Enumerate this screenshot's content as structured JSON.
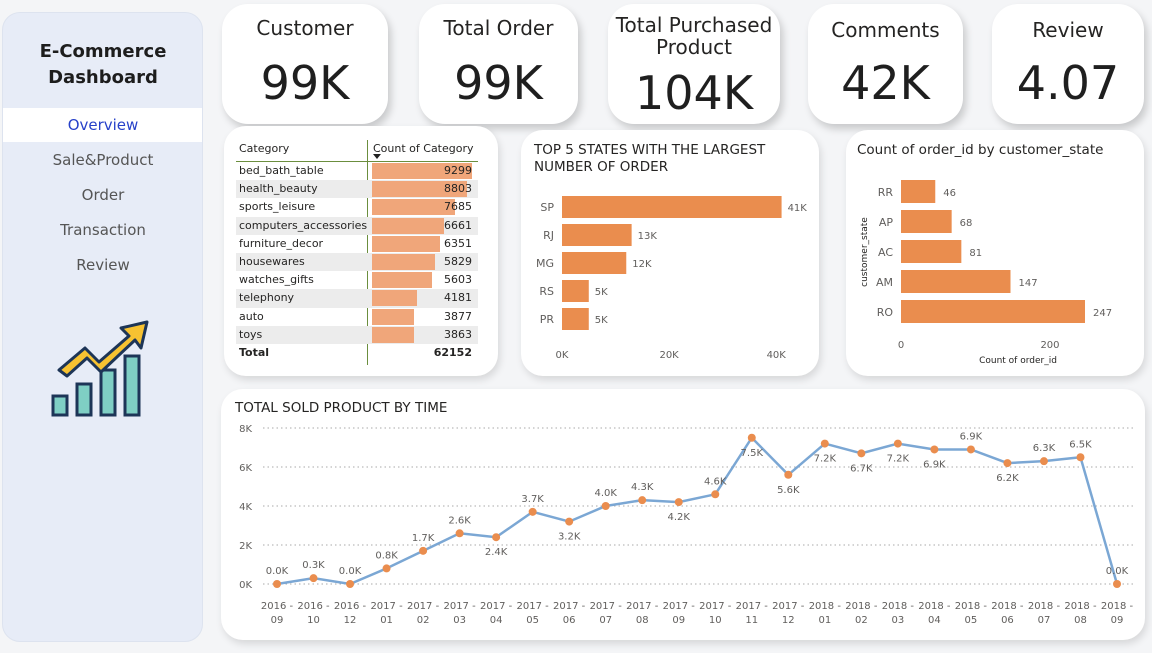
{
  "sidebar": {
    "title_line1": "E-Commerce",
    "title_line2": "Dashboard",
    "nav": [
      "Overview",
      "Sale&Product",
      "Order",
      "Transaction",
      "Review"
    ]
  },
  "kpis": [
    {
      "title": "Customer",
      "value": "99K"
    },
    {
      "title": "Total Order",
      "value": "99K"
    },
    {
      "title_line1": "Total Purchased",
      "title_line2": "Product",
      "value": "104K"
    },
    {
      "title": "Comments",
      "value": "42K"
    },
    {
      "title": "Review",
      "value": "4.07"
    }
  ],
  "category_table": {
    "col_category": "Category",
    "col_count": "Count of Category",
    "rows": [
      {
        "category": "bed_bath_table",
        "count": "9299"
      },
      {
        "category": "health_beauty",
        "count": "8803"
      },
      {
        "category": "sports_leisure",
        "count": "7685"
      },
      {
        "category": "computers_accessories",
        "count": "6661"
      },
      {
        "category": "furniture_decor",
        "count": "6351"
      },
      {
        "category": "housewares",
        "count": "5829"
      },
      {
        "category": "watches_gifts",
        "count": "5603"
      },
      {
        "category": "telephony",
        "count": "4181"
      },
      {
        "category": "auto",
        "count": "3877"
      },
      {
        "category": "toys",
        "count": "3863"
      }
    ],
    "total_label": "Total",
    "total_value": "62152"
  },
  "colors": {
    "bar": "#ea8d4e",
    "table_bar": "#f0a67a",
    "line": "#7ba7d4",
    "marker": "#ea8d4e",
    "nav_active": "#2741c9"
  },
  "icons": {
    "growth": "growth-chart-icon"
  },
  "chart_data": [
    {
      "type": "bar",
      "orientation": "horizontal",
      "title_line1": "TOP 5 STATES WITH THE LARGEST",
      "title_line2": "NUMBER OF ORDER",
      "categories": [
        "SP",
        "RJ",
        "MG",
        "RS",
        "PR"
      ],
      "values": [
        41000,
        13000,
        12000,
        5000,
        5000
      ],
      "data_labels": [
        "41K",
        "13K",
        "12K",
        "5K",
        "5K"
      ],
      "x_ticks": [
        "0K",
        "20K",
        "40K"
      ],
      "xlim": [
        0,
        45000
      ]
    },
    {
      "type": "bar",
      "orientation": "horizontal",
      "title": "Count of order_id by customer_state",
      "xlabel": "Count of order_id",
      "ylabel": "customer_state",
      "categories": [
        "RR",
        "AP",
        "AC",
        "AM",
        "RO"
      ],
      "values": [
        46,
        68,
        81,
        147,
        247
      ],
      "x_ticks": [
        "0",
        "200"
      ],
      "xlim": [
        0,
        262
      ]
    },
    {
      "type": "line",
      "title": "TOTAL SOLD PRODUCT BY TIME",
      "x": [
        "2016 - 09",
        "2016 - 10",
        "2016 - 12",
        "2017 - 01",
        "2017 - 02",
        "2017 - 03",
        "2017 - 04",
        "2017 - 05",
        "2017 - 06",
        "2017 - 07",
        "2017 - 08",
        "2017 - 09",
        "2017 - 10",
        "2017 - 11",
        "2017 - 12",
        "2018 - 01",
        "2018 - 02",
        "2018 - 03",
        "2018 - 04",
        "2018 - 05",
        "2018 - 06",
        "2018 - 07",
        "2018 - 08",
        "2018 - 09"
      ],
      "values": [
        0,
        300,
        0,
        800,
        1700,
        2600,
        2400,
        3700,
        3200,
        4000,
        4300,
        4200,
        4600,
        7500,
        5600,
        7200,
        6700,
        7200,
        6900,
        6900,
        6200,
        6300,
        6500,
        0
      ],
      "data_labels": [
        "0.0K",
        "0.3K",
        "0.0K",
        "0.8K",
        "1.7K",
        "2.6K",
        "2.4K",
        "3.7K",
        "3.2K",
        "4.0K",
        "4.3K",
        "4.2K",
        "4.6K",
        "7.5K",
        "5.6K",
        "7.2K",
        "6.7K",
        "7.2K",
        "6.9K",
        "6.9K",
        "6.2K",
        "6.3K",
        "6.5K",
        "0.0K"
      ],
      "label_above": [
        true,
        true,
        true,
        true,
        true,
        true,
        false,
        true,
        false,
        true,
        true,
        false,
        true,
        false,
        false,
        false,
        false,
        false,
        false,
        true,
        false,
        true,
        true,
        true
      ],
      "y_ticks": [
        "0K",
        "2K",
        "4K",
        "6K",
        "8K"
      ],
      "ylim": [
        0,
        8000
      ],
      "grid": true
    }
  ]
}
